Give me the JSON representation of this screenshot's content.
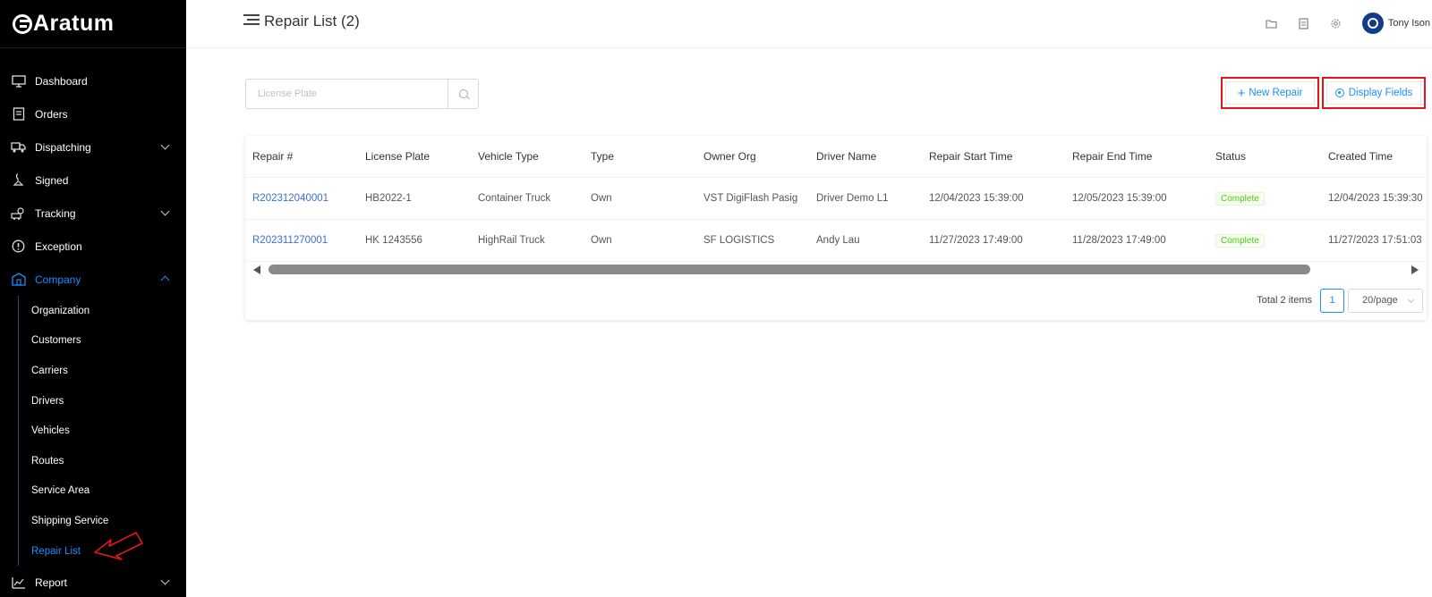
{
  "app": {
    "logo_text": "Aratum"
  },
  "sidebar": {
    "items": [
      {
        "label": "Dashboard",
        "icon": "monitor-icon"
      },
      {
        "label": "Orders",
        "icon": "orders-icon"
      },
      {
        "label": "Dispatching",
        "icon": "truck-icon",
        "expandable": true
      },
      {
        "label": "Signed",
        "icon": "signature-icon"
      },
      {
        "label": "Tracking",
        "icon": "tracking-icon",
        "expandable": true
      },
      {
        "label": "Exception",
        "icon": "exception-icon"
      },
      {
        "label": "Company",
        "icon": "company-icon",
        "expandable": true,
        "expanded": true,
        "active": true
      }
    ],
    "company_sub": [
      "Organization",
      "Customers",
      "Carriers",
      "Drivers",
      "Vehicles",
      "Routes",
      "Service Area",
      "Shipping Service",
      "Repair List"
    ],
    "active_sub": "Repair List",
    "report": {
      "label": "Report",
      "icon": "chart-icon"
    }
  },
  "header": {
    "title": "Repair List (2)",
    "user_name": "Tony Ison",
    "icons": [
      "folder-icon",
      "document-icon",
      "gear-icon"
    ]
  },
  "search": {
    "placeholder": "License Plate",
    "value": ""
  },
  "actions": {
    "new_repair": "New Repair",
    "display_fields": "Display Fields"
  },
  "table": {
    "columns": [
      "Repair #",
      "License Plate",
      "Vehicle Type",
      "Type",
      "Owner Org",
      "Driver Name",
      "Repair Start Time",
      "Repair End Time",
      "Status",
      "Created Time"
    ],
    "rows": [
      [
        "R202312040001",
        "HB2022-1",
        "Container Truck",
        "Own",
        "VST DigiFlash Pasig",
        "Driver Demo L1",
        "12/04/2023 15:39:00",
        "12/05/2023 15:39:00",
        "Complete",
        "12/04/2023 15:39:30"
      ],
      [
        "R202311270001",
        "HK 1243556",
        "HighRail Truck",
        "Own",
        "SF LOGISTICS",
        "Andy Lau",
        "11/27/2023 17:49:00",
        "11/28/2023 17:49:00",
        "Complete",
        "11/27/2023 17:51:03"
      ]
    ]
  },
  "pagination": {
    "total": "Total 2 items",
    "current": "1",
    "page_size": "20/page"
  },
  "colors": {
    "accent": "#1890ff",
    "highlight": "#e8141c",
    "sidebar_bg": "#000000",
    "status_green": "#52c41a"
  }
}
